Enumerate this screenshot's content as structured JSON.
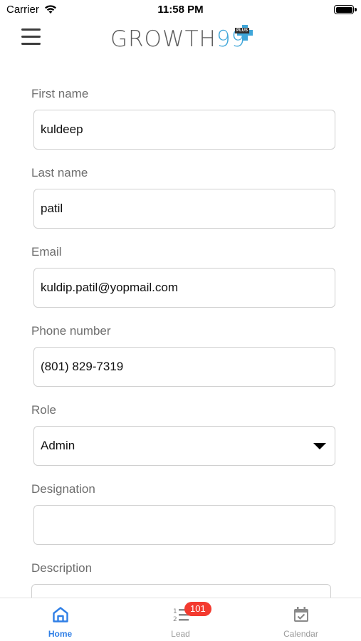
{
  "status_bar": {
    "carrier": "Carrier",
    "time": "11:58 PM"
  },
  "header": {
    "logo_text": "GROWTH",
    "logo_digits": "99",
    "logo_tag": "PLUS",
    "icons": [
      "menu-icon"
    ]
  },
  "form": {
    "fields": [
      {
        "label": "First name",
        "value": "kuldeep"
      },
      {
        "label": "Last name",
        "value": "patil"
      },
      {
        "label": "Email",
        "value": "kuldip.patil@yopmail.com"
      },
      {
        "label": "Phone number",
        "value": "(801) 829-7319"
      },
      {
        "label": "Role",
        "value": "Admin",
        "type": "select"
      },
      {
        "label": "Designation",
        "value": ""
      },
      {
        "label": "Description",
        "value": ""
      }
    ]
  },
  "tabbar": {
    "tabs": [
      {
        "label": "Home",
        "icon": "home-icon",
        "active": true
      },
      {
        "label": "Lead",
        "icon": "list-icon",
        "badge": "101"
      },
      {
        "label": "Calendar",
        "icon": "calendar-icon"
      }
    ]
  },
  "colors": {
    "accent": "#2f7fe6",
    "brand": "#3fa6d9",
    "badge": "#f33a2f"
  }
}
